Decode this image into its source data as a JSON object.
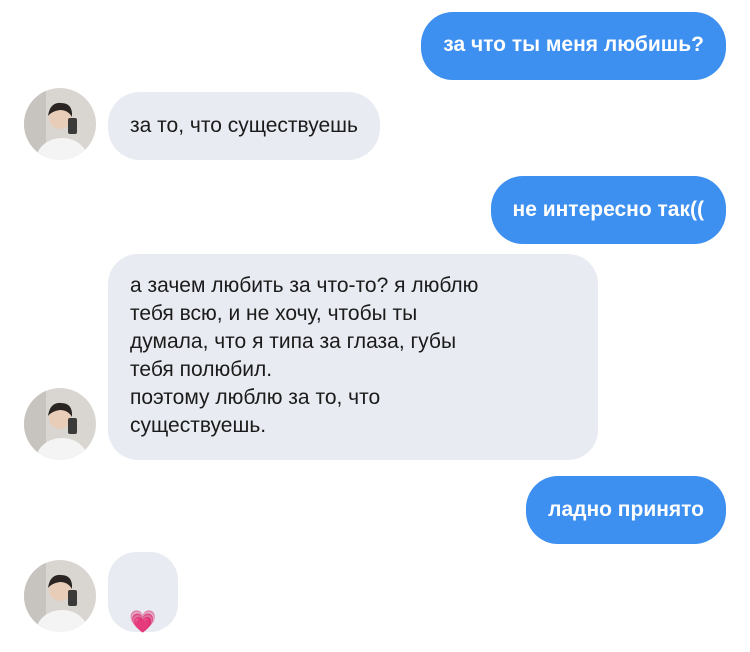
{
  "chat": {
    "messages": [
      {
        "side": "out",
        "text": "за что ты меня любишь?"
      },
      {
        "side": "in",
        "text": "за то, что существуешь"
      },
      {
        "side": "out",
        "text": "не интересно так(("
      },
      {
        "side": "in",
        "text": "а зачем любить за что-то? я люблю\nтебя всю, и не хочу, чтобы ты\nдумала, что я типа за глаза, губы\nтебя полюбил.\nпоэтому люблю за то, что\nсуществуешь."
      },
      {
        "side": "out",
        "text": "ладно принято"
      },
      {
        "side": "in",
        "text": "💗"
      }
    ]
  },
  "colors": {
    "outgoing_bubble": "#3d8ff0",
    "incoming_bubble": "#e9ebf2",
    "outgoing_text": "#ffffff",
    "incoming_text": "#1b1b1b"
  },
  "icons": {
    "avatar": "contact-avatar",
    "heart": "pink-heart-emoji"
  }
}
